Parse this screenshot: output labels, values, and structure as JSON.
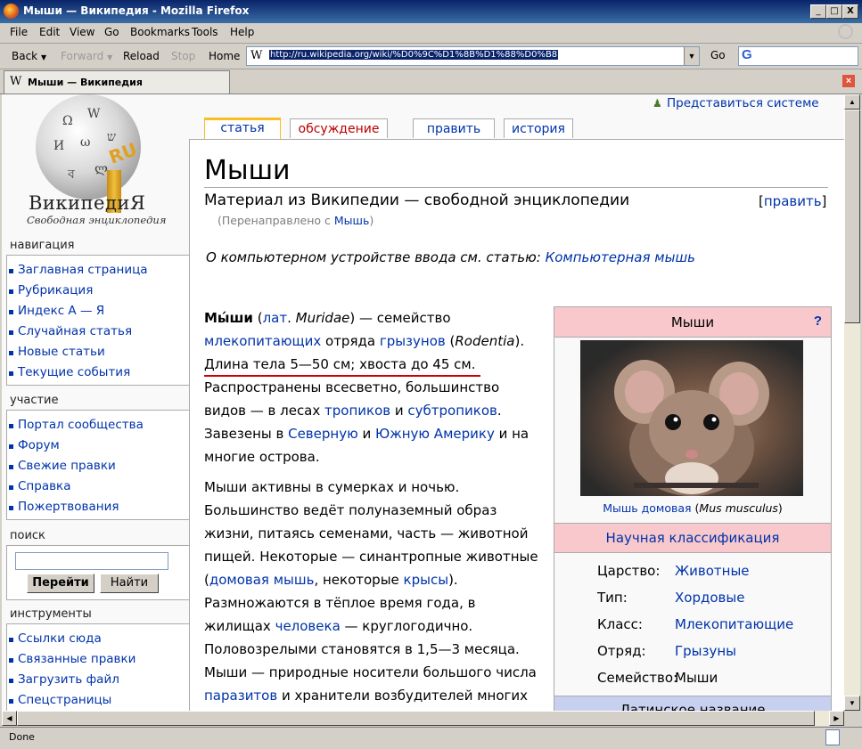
{
  "window": {
    "title": "Мыши — Википедия - Mozilla Firefox",
    "buttons": [
      "_",
      "□",
      "X"
    ]
  },
  "menu": [
    "File",
    "Edit",
    "View",
    "Go",
    "Bookmarks",
    "Tools",
    "Help"
  ],
  "toolbar": {
    "back": "Back",
    "forward": "Forward",
    "reload": "Reload",
    "stop": "Stop",
    "home": "Home",
    "url": "http://ru.wikipedia.org/wiki/%D0%9C%D1%8B%D1%88%D0%B8",
    "go": "Go",
    "site_icon": "W",
    "search_engine_icon": "G"
  },
  "tab": {
    "title": "Мыши — Википедия",
    "icon": "W"
  },
  "status": "Done",
  "wiki": {
    "logo": {
      "name": "ВикипедиЯ",
      "slogan": "Свободная энциклопедия",
      "badge": "RU"
    },
    "login": "Представиться системе",
    "tabs": {
      "article": "статья",
      "discussion": "обсуждение",
      "edit": "править",
      "history": "история"
    },
    "sidebar": {
      "navigation": {
        "title": "навигация",
        "items": [
          "Заглавная страница",
          "Рубрикация",
          "Индекс А — Я",
          "Случайная статья",
          "Новые статьи",
          "Текущие события"
        ]
      },
      "participation": {
        "title": "участие",
        "items": [
          "Портал сообщества",
          "Форум",
          "Свежие правки",
          "Справка",
          "Пожертвования"
        ]
      },
      "search": {
        "title": "поиск",
        "go": "Перейти",
        "find": "Найти"
      },
      "tools": {
        "title": "инструменты",
        "items": [
          "Ссылки сюда",
          "Связанные правки",
          "Загрузить файл",
          "Спецстраницы"
        ]
      }
    },
    "article": {
      "title": "Мыши",
      "subtitle": "Материал из Википедии — свободной энциклопедии",
      "edit_link": "править",
      "redirect_prefix": "(Перенаправлено с ",
      "redirect_link": "Мышь",
      "redirect_suffix": ")",
      "dab_text": "О компьютерном устройстве ввода см. статью: ",
      "dab_link": "Компьютерная мышь",
      "p1": {
        "bold": "Мы́ши",
        "lat": "лат",
        "latin": "Muridae",
        "t1": ") — семейство",
        "link1": "млекопитающих",
        "t2": " отряда ",
        "link2": "грызунов",
        "t3": " (",
        "rodentia": "Rodentia",
        "t4": ").",
        "highlight": "Длина тела 5—50 см; хвоста до 45 см.",
        "t5": "Распространены всесветно, большинство видов — в лесах ",
        "link3": "тропиков",
        "t6": " и ",
        "link4": "субтропиков",
        "t7": ". Завезены в ",
        "link5": "Северную",
        "t8": " и ",
        "link6": "Южную Америку",
        "t9": " и на многие острова."
      },
      "p2": {
        "t1": "Мыши активны в сумерках и ночью. Большинство ведёт полуназемный образ жизни, питаясь семенами, часть — животной пищей. Некоторые — синантропные животные (",
        "link1": "домовая мышь",
        "t2": ", некоторые ",
        "link2": "крысы",
        "t3": "). Размножаются в тёплое время года, в жилищах ",
        "link3": "человека",
        "t4": " — круглогодично. Половозрелыми становятся в 1,5—3 месяца. Мыши — природные носители большого числа ",
        "link4": "паразитов",
        "t5": " и хранители возбудителей многих"
      }
    },
    "infobox": {
      "title": "Мыши",
      "help": "?",
      "caption_link": "Мышь домовая",
      "caption_latin": "Mus musculus",
      "classification": "Научная классификация",
      "rows": [
        {
          "label": "Царство:",
          "value": "Животные"
        },
        {
          "label": "Тип:",
          "value": "Хордовые"
        },
        {
          "label": "Класс:",
          "value": "Млекопитающие"
        },
        {
          "label": "Отряд:",
          "value": "Грызуны"
        },
        {
          "label": "Семейство:",
          "value": "Мыши"
        }
      ],
      "latin_name": "Латинское название"
    }
  }
}
